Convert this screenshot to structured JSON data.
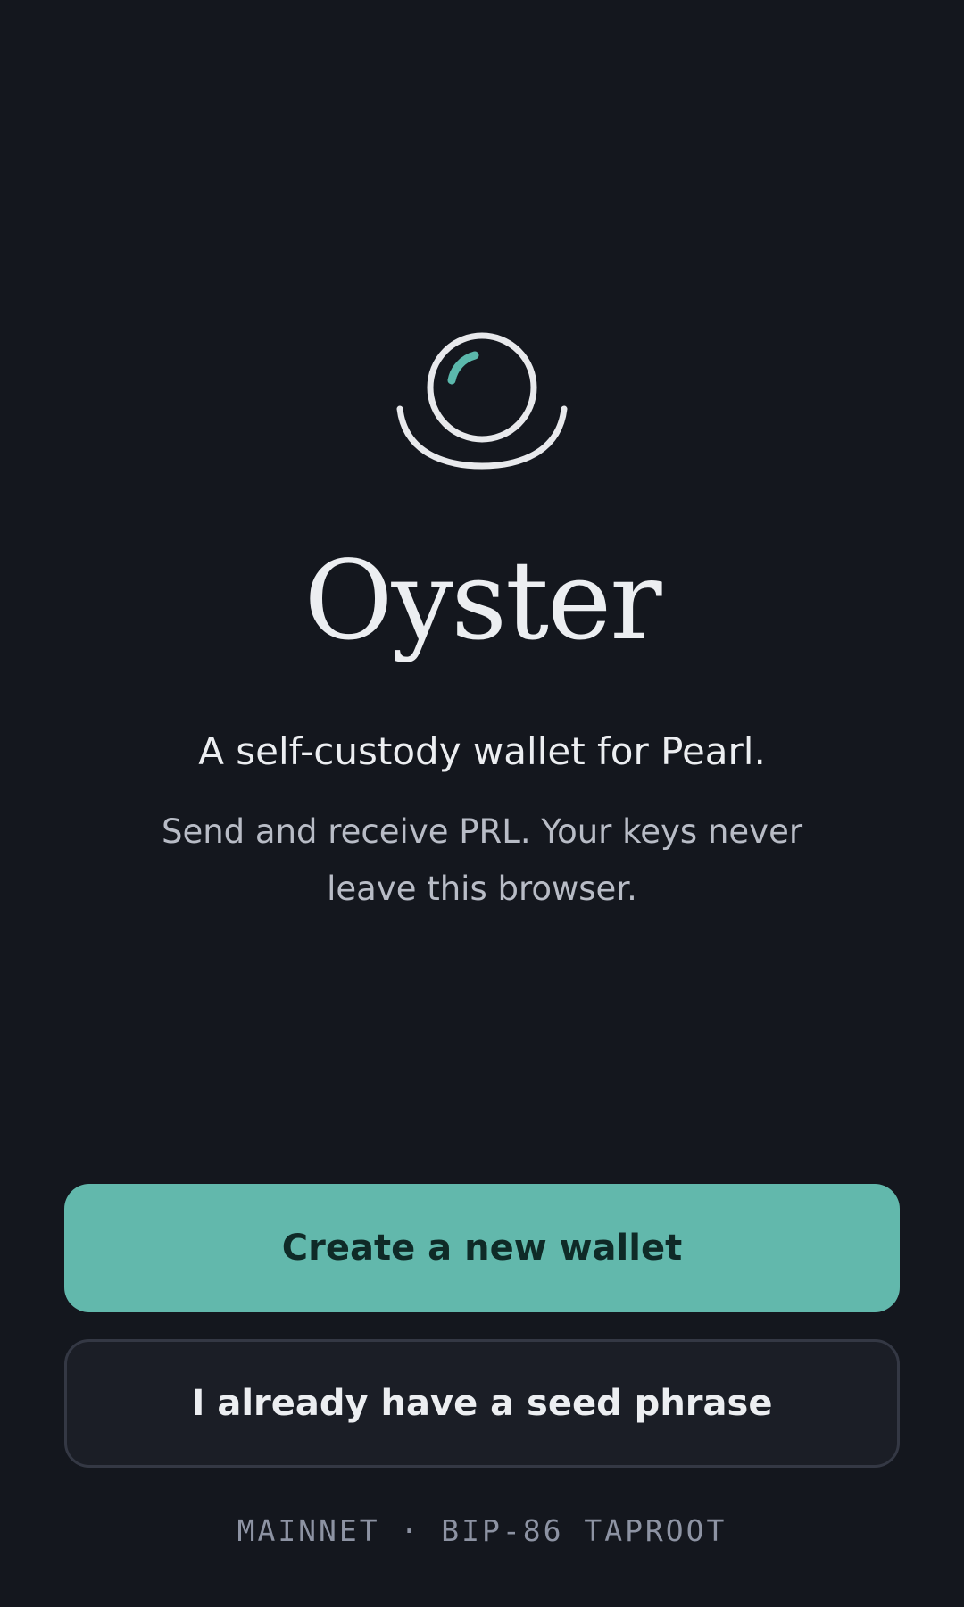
{
  "logo": {
    "icon": "oyster-pearl-icon",
    "accent_color": "#5bb8ac",
    "stroke_color": "#e8e9ec"
  },
  "app": {
    "title": "Oyster",
    "tagline": "A self-custody wallet for Pearl.",
    "description": "Send and receive PRL. Your keys never leave this browser."
  },
  "actions": {
    "create_label": "Create a new wallet",
    "restore_label": "I already have a seed phrase"
  },
  "footer": {
    "network": "MAINNET · BIP-86 TAPROOT"
  },
  "colors": {
    "background": "#14171e",
    "primary": "#62b8ac",
    "secondary_border": "#343844"
  }
}
